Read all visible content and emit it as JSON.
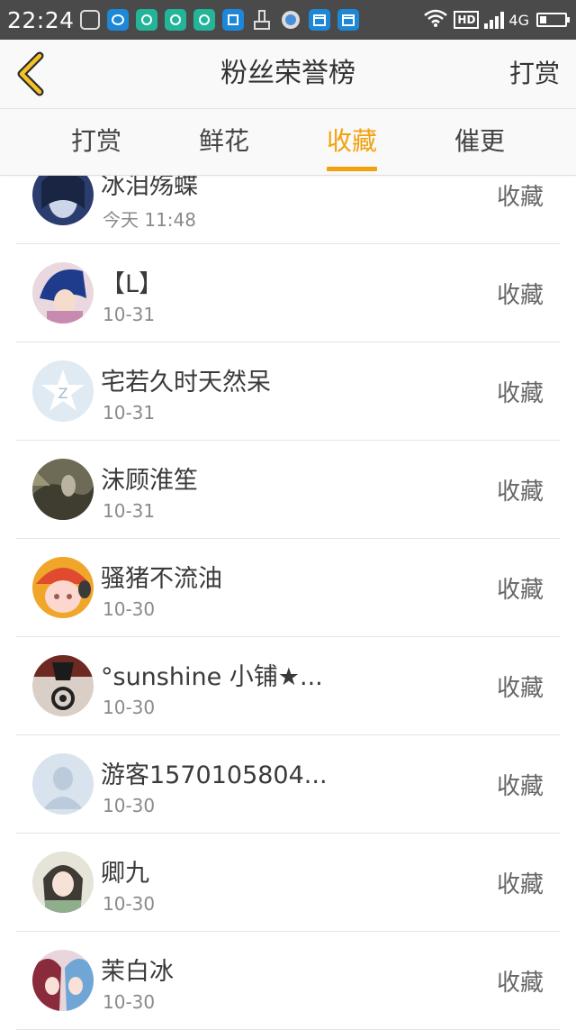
{
  "status_bar": {
    "time": "22:24",
    "network": "4G",
    "hd": "HD",
    "icons": [
      "robot-icon",
      "qq-icon",
      "app-icon",
      "app-icon",
      "app-icon",
      "scan-icon",
      "brush-icon",
      "fly-icon",
      "calendar-icon",
      "calendar-icon"
    ]
  },
  "nav": {
    "title": "粉丝荣誉榜",
    "action": "打赏",
    "accent": "#f3a10c"
  },
  "tabs": [
    {
      "label": "打赏",
      "active": false
    },
    {
      "label": "鲜花",
      "active": false
    },
    {
      "label": "收藏",
      "active": true
    },
    {
      "label": "催更",
      "active": false
    }
  ],
  "list": [
    {
      "name": "冰泪殇蝶",
      "date": "今天 11:48",
      "action": "收藏",
      "avatar": "dark-blue"
    },
    {
      "name": "【L】",
      "date": "10-31",
      "action": "收藏",
      "avatar": "anime-blue"
    },
    {
      "name": "宅若久时天然呆",
      "date": "10-31",
      "action": "收藏",
      "avatar": "default-star"
    },
    {
      "name": "沫顾淮笙",
      "date": "10-31",
      "action": "收藏",
      "avatar": "landscape"
    },
    {
      "name": "骚猪不流油",
      "date": "10-30",
      "action": "收藏",
      "avatar": "pig"
    },
    {
      "name": "°sunshine 小铺★...",
      "date": "10-30",
      "action": "收藏",
      "avatar": "dark-logo"
    },
    {
      "name": "游客1570105804...",
      "date": "10-30",
      "action": "收藏",
      "avatar": "default-person"
    },
    {
      "name": "卿九",
      "date": "10-30",
      "action": "收藏",
      "avatar": "anime-girl"
    },
    {
      "name": "茉白冰",
      "date": "10-30",
      "action": "收藏",
      "avatar": "anime-pair"
    }
  ]
}
